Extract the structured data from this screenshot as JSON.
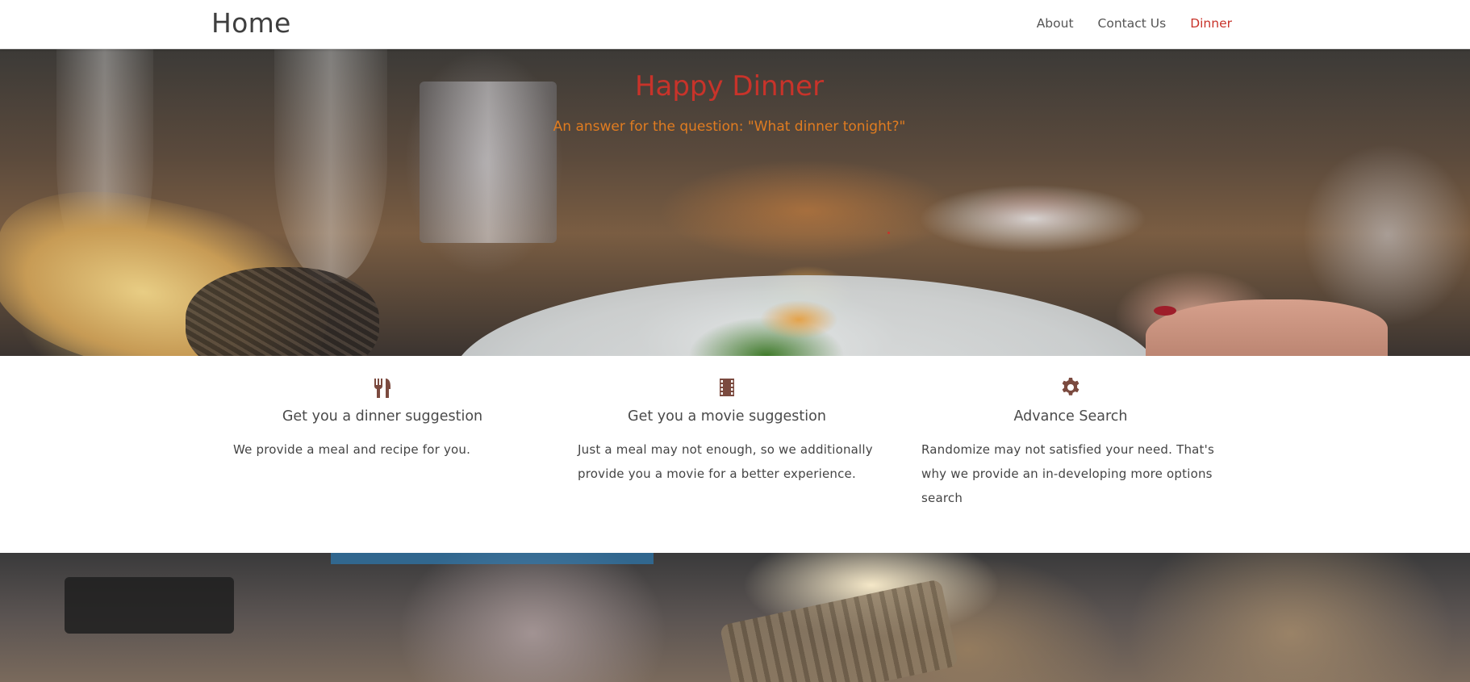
{
  "navbar": {
    "brand": "Home",
    "links": [
      {
        "label": "About",
        "active": false
      },
      {
        "label": "Contact Us",
        "active": false
      },
      {
        "label": "Dinner",
        "active": true
      }
    ]
  },
  "hero": {
    "title": "Happy Dinner",
    "subtitle": "An answer for the question: \"What dinner tonight?\""
  },
  "features": [
    {
      "icon": "utensils-icon",
      "title": "Get you a dinner suggestion",
      "text": "We provide a meal and recipe for you."
    },
    {
      "icon": "film-icon",
      "title": "Get you a movie suggestion",
      "text": "Just a meal may not enough, so we additionally provide you a movie for a better experience."
    },
    {
      "icon": "gear-icon",
      "title": "Advance Search",
      "text": "Randomize may not satisfied your need. That's why we provide an in-developing more options search"
    }
  ],
  "colors": {
    "accent": "#c8332a",
    "subtitle": "#e07c20",
    "icon": "#7b4a3f",
    "text": "#444444"
  }
}
